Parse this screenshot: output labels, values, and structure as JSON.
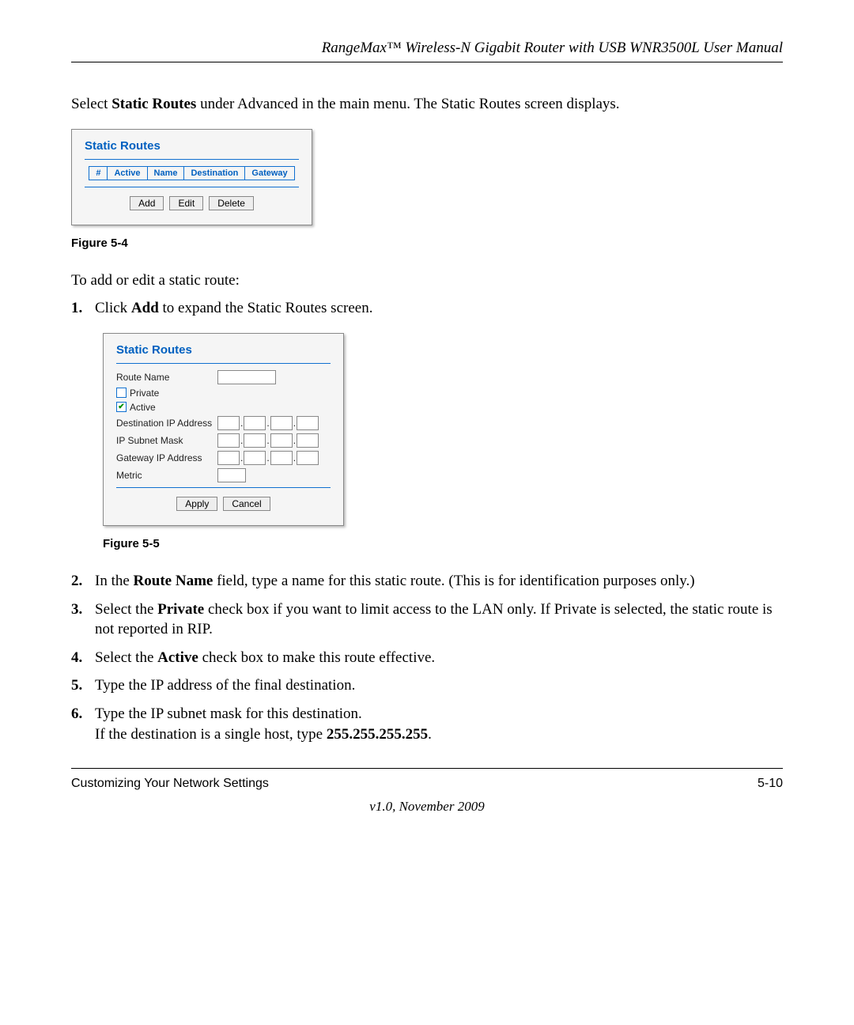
{
  "header": {
    "title": "RangeMax™ Wireless-N Gigabit Router with USB WNR3500L User Manual"
  },
  "intro": {
    "text_before": "Select ",
    "bold": "Static Routes",
    "text_after": " under Advanced in the main menu. The Static Routes screen displays."
  },
  "fig4": {
    "panel_title": "Static Routes",
    "columns": {
      "hash": "#",
      "active": "Active",
      "name": "Name",
      "dest": "Destination",
      "gw": "Gateway"
    },
    "buttons": {
      "add": "Add",
      "edit": "Edit",
      "delete": "Delete"
    },
    "caption": "Figure 5-4"
  },
  "add_edit_line": "To add or edit a static route:",
  "step1": {
    "num": "1.",
    "before": "Click ",
    "bold": "Add",
    "after": " to expand the Static Routes screen."
  },
  "fig5": {
    "panel_title": "Static Routes",
    "labels": {
      "route_name": "Route Name",
      "private": "Private",
      "active": "Active",
      "dest_ip": "Destination IP Address",
      "subnet": "IP Subnet Mask",
      "gateway": "Gateway IP Address",
      "metric": "Metric"
    },
    "buttons": {
      "apply": "Apply",
      "cancel": "Cancel"
    },
    "caption": "Figure 5-5"
  },
  "step2": {
    "num": "2.",
    "before": "In the ",
    "bold": "Route Name",
    "after": " field, type a name for this static route. (This is for identification purposes only.)"
  },
  "step3": {
    "num": "3.",
    "before": "Select the ",
    "bold": "Private",
    "after": " check box if you want to limit access to the LAN only. If Private is selected, the static route is not reported in RIP."
  },
  "step4": {
    "num": "4.",
    "before": "Select the ",
    "bold": "Active",
    "after": " check box to make this route effective."
  },
  "step5": {
    "num": "5.",
    "text": "Type the IP address of the final destination."
  },
  "step6": {
    "num": "6.",
    "line1": "Type the IP subnet mask for this destination.",
    "line2_before": "If the destination is a single host, type ",
    "line2_bold": "255.255.255.255",
    "line2_after": "."
  },
  "footer": {
    "left": "Customizing Your Network Settings",
    "right": "5-10",
    "version": "v1.0, November 2009"
  }
}
